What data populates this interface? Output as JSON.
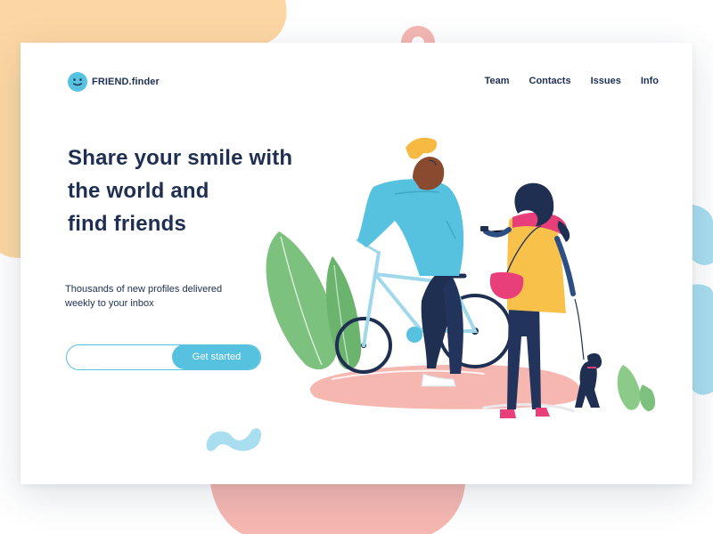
{
  "brand": {
    "name": "FRIEND.finder",
    "icon": "smiley-face-icon"
  },
  "nav": {
    "items": [
      {
        "label": "Team"
      },
      {
        "label": "Contacts"
      },
      {
        "label": "Issues"
      },
      {
        "label": "Info"
      }
    ]
  },
  "hero": {
    "title_lines": [
      "Share your smile with",
      "the world and",
      "find friends"
    ],
    "subtitle_lines": [
      "Thousands of new profiles delivered",
      "weekly to your inbox"
    ]
  },
  "signup": {
    "email_value": "",
    "email_placeholder": "",
    "button_label": "Get started"
  },
  "colors": {
    "navy": "#1e2f52",
    "accent_blue": "#56c2e0",
    "peach": "#fdd7a3",
    "pink": "#f6b7b1",
    "green": "#7cc17d",
    "sky": "#a8def0"
  }
}
